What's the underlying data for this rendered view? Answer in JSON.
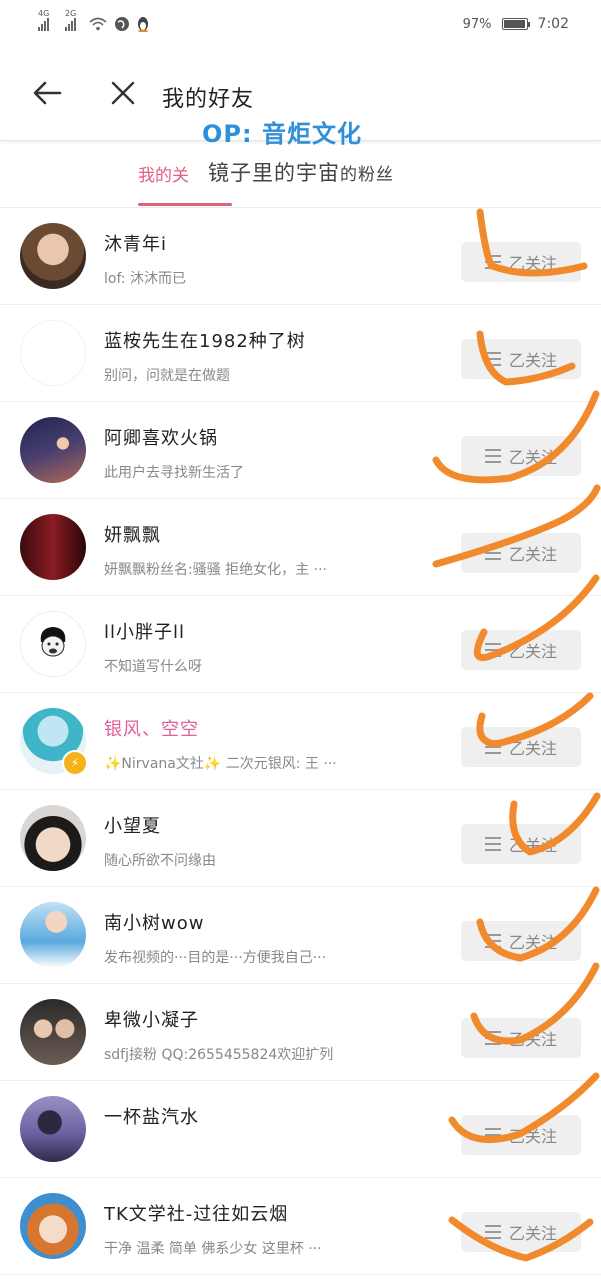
{
  "status": {
    "net1": "4G",
    "net2": "2G",
    "battery": "97%",
    "battery_level": 0.97,
    "time": "7:02"
  },
  "header": {
    "title": "我的好友",
    "watermark": "OP: 音炬文化"
  },
  "tabs": {
    "active": "我的关",
    "overlay": "镜子里的宇宙",
    "overlay_suffix": "的粉丝"
  },
  "follow_label": "乙关注",
  "friends": [
    {
      "name": "沐青年i",
      "sub": "lof: 沐沐而已"
    },
    {
      "name": "蓝桉先生在1982种了树",
      "sub": "别问，问就是在做题"
    },
    {
      "name": "阿卿喜欢火锅",
      "sub": "此用户去寻找新生活了"
    },
    {
      "name": "妍飘飘",
      "sub": "妍飘飘粉丝名:骚骚 拒绝女化，主 ···"
    },
    {
      "name": "ll小胖子ll",
      "sub": "不知道写什么呀"
    },
    {
      "name": "银风、空空",
      "sub": "✨Nirvana文社✨ 二次元银风: 王 ···"
    },
    {
      "name": "小望夏",
      "sub": "随心所欲不问缘由"
    },
    {
      "name": "南小树wow",
      "sub": "发布视频的···目的是···方便我自己···"
    },
    {
      "name": "卑微小凝子",
      "sub": "sdfj接粉 QQ:2655455824欢迎扩列"
    },
    {
      "name": "一杯盐汽水",
      "sub": ""
    },
    {
      "name": "TK文学社-过往如云烟",
      "sub": "干净 温柔 简单 佛系少女 这里杯 ···"
    }
  ],
  "colors": {
    "accent": "#e0607e",
    "scribble": "#f08a2c",
    "watermark": "#2f8fd8"
  }
}
